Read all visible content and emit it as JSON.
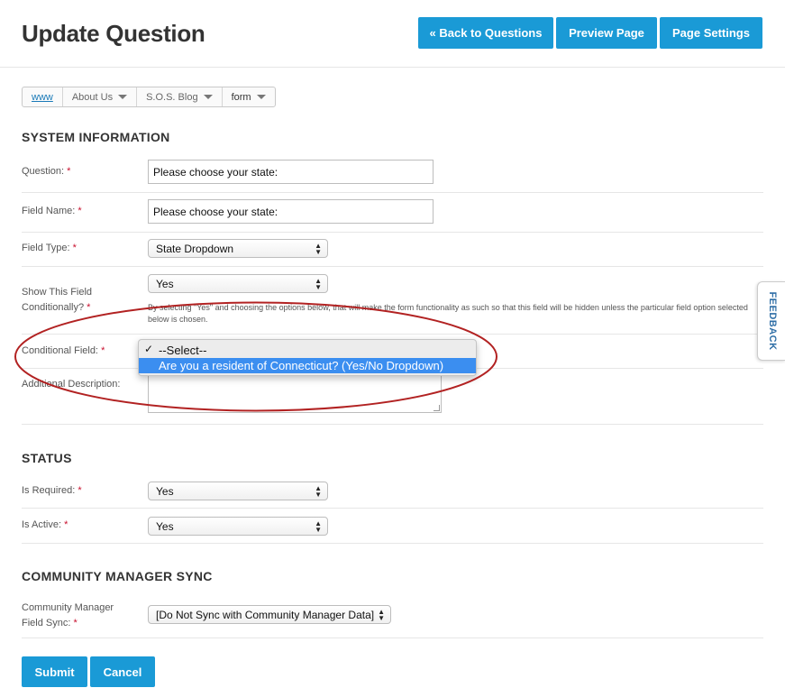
{
  "header": {
    "title": "Update Question",
    "back_label": "« Back to Questions",
    "preview_label": "Preview Page",
    "settings_label": "Page Settings"
  },
  "breadcrumb": [
    {
      "label": "www"
    },
    {
      "label": "About Us"
    },
    {
      "label": "S.O.S. Blog"
    },
    {
      "label": "form"
    }
  ],
  "system": {
    "title": "SYSTEM INFORMATION",
    "question_label": "Question:",
    "question_value": "Please choose your state:",
    "field_name_label": "Field Name:",
    "field_name_value": "Please choose your state:",
    "field_type_label": "Field Type:",
    "field_type_value": "State Dropdown",
    "show_cond_label_1": "Show This Field",
    "show_cond_label_2": "Conditionally?",
    "show_cond_value": "Yes",
    "show_cond_help": "By selecting \"Yes\" and choosing the options below, that will make the form functionality as such so that this field will be hidden unless the particular field option selected below is chosen.",
    "cond_field_label": "Conditional Field:",
    "cond_field_options": [
      "--Select--",
      "Are you a resident of Connecticut? (Yes/No Dropdown)"
    ],
    "cond_field_check": "✓",
    "additional_label": "Additional Description:",
    "required_mark": "*"
  },
  "status": {
    "title": "STATUS",
    "required_label": "Is Required:",
    "required_value": "Yes",
    "active_label": "Is Active:",
    "active_value": "Yes"
  },
  "community": {
    "title": "COMMUNITY MANAGER SYNC",
    "sync_label_1": "Community Manager",
    "sync_label_2": "Field Sync:",
    "sync_value": "[Do Not Sync with Community Manager Data]"
  },
  "actions": {
    "submit_label": "Submit",
    "cancel_label": "Cancel"
  },
  "feedback_label": "FEEDBACK",
  "colors": {
    "accent": "#1a9ad6",
    "required": "#c8102e",
    "highlight_ellipse": "#b22222",
    "option_selected": "#3b8ef0"
  }
}
